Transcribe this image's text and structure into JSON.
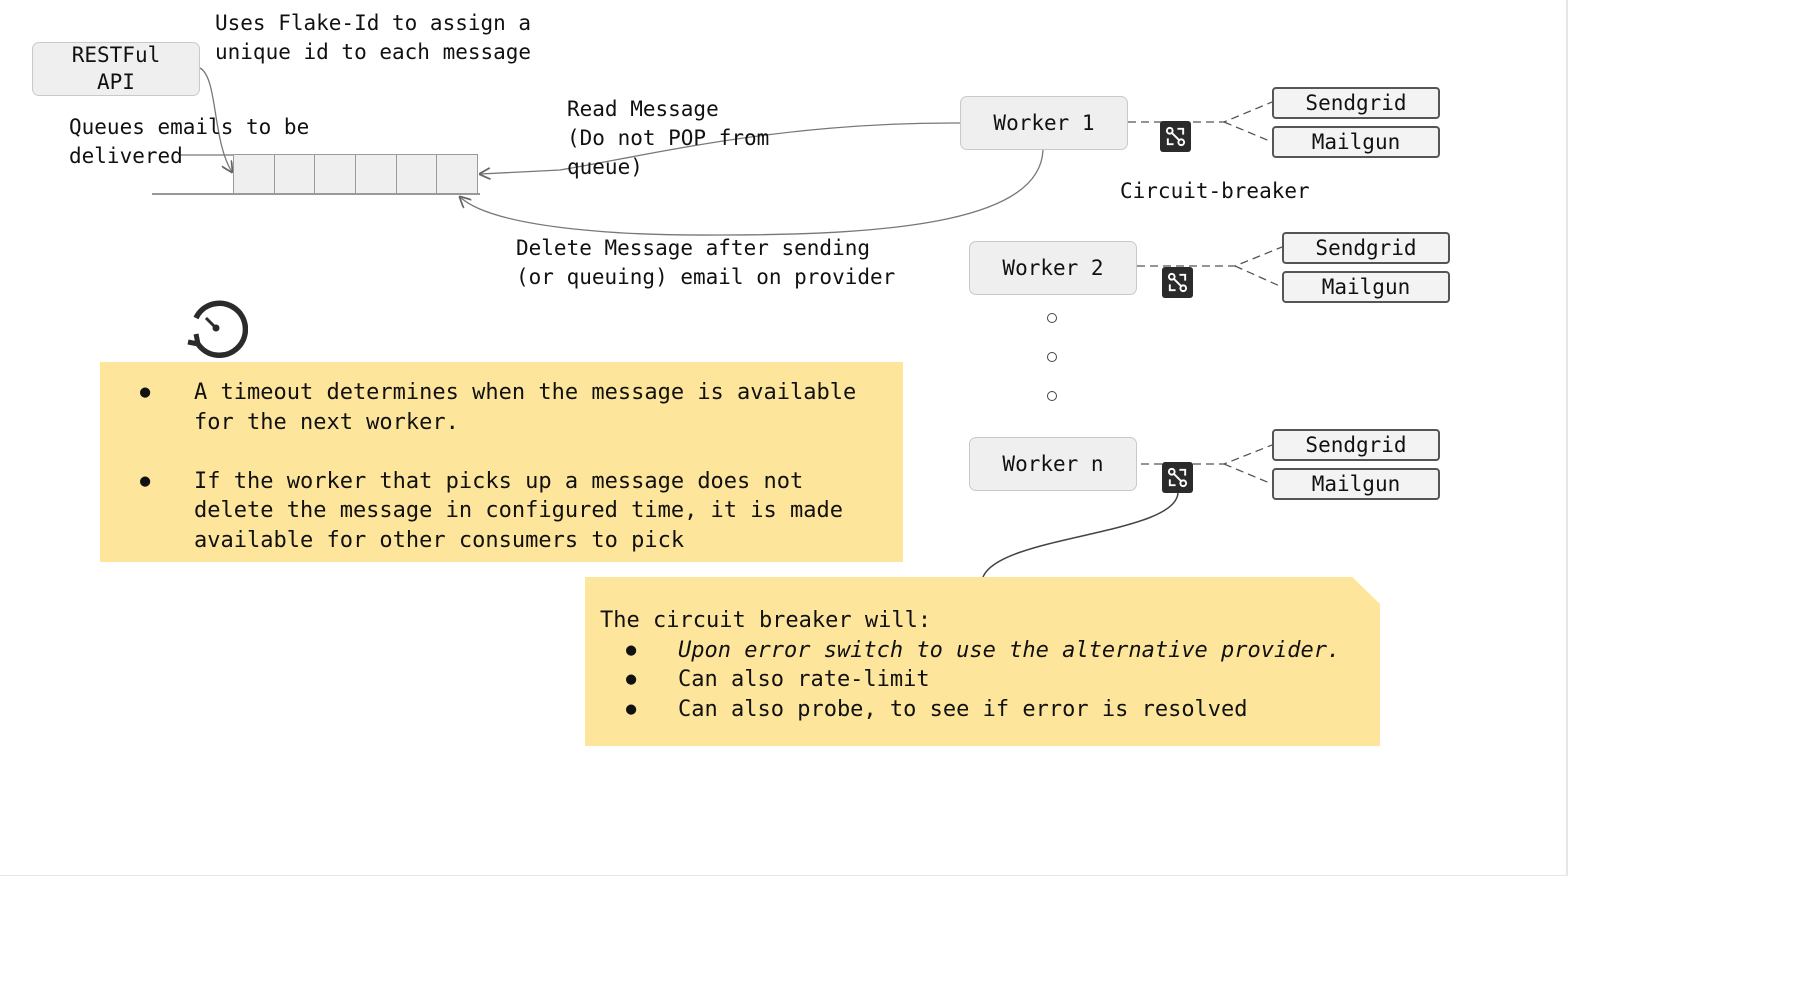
{
  "api_box": "RESTFul\nAPI",
  "flake_note": "Uses Flake-Id to assign a\nunique id to each message",
  "queue_note": "Queues emails to be\ndelivered",
  "read_note": "Read Message\n(Do not POP from\nqueue)",
  "delete_note": "Delete Message after sending\n(or queuing) email on provider",
  "circuit_label": "Circuit-breaker",
  "workers": [
    {
      "label": "Worker 1",
      "providers": [
        "Sendgrid",
        "Mailgun"
      ]
    },
    {
      "label": "Worker 2",
      "providers": [
        "Sendgrid",
        "Mailgun"
      ]
    },
    {
      "label": "Worker n",
      "providers": [
        "Sendgrid",
        "Mailgun"
      ]
    }
  ],
  "icons": [
    "timer-icon",
    "circuit-breaker-icon"
  ],
  "timeout_notes": [
    "A timeout determines when the message is available\nfor the next worker.",
    "If the worker that picks up a message does not\ndelete the message in configured time, it is made\navailable for other consumers to pick"
  ],
  "circuit_note": {
    "heading": "The circuit breaker will:",
    "items": [
      "Upon error switch to use the alternative provider.",
      "Can also rate-limit",
      "Can also probe, to see if error is resolved"
    ]
  },
  "colors": {
    "note_bg": "#fde59b",
    "box_bg": "#efefef",
    "line": "#555555"
  }
}
